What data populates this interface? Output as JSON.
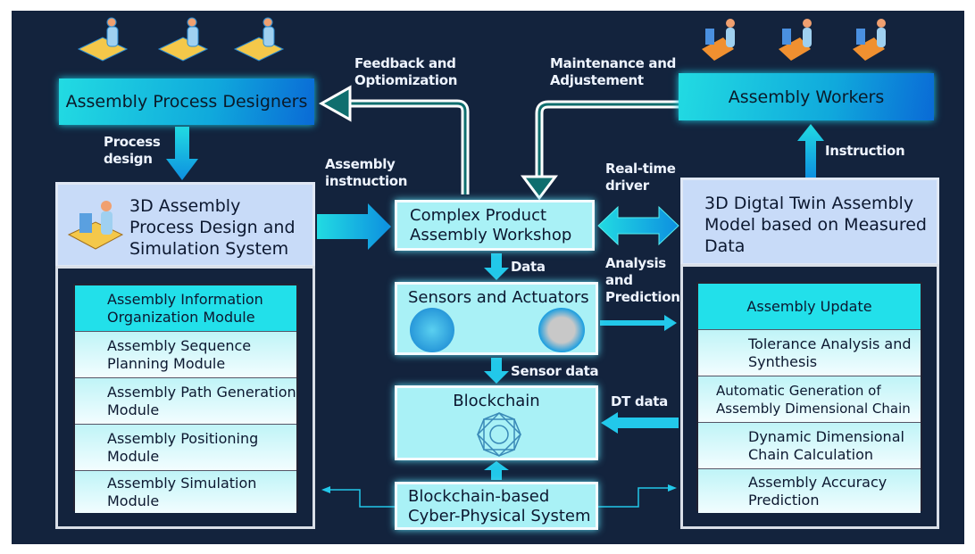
{
  "designers": {
    "title": "Assembly Process Designers",
    "icon": "designer-person-icon"
  },
  "workers": {
    "title": "Assembly Workers",
    "icon": "worker-person-icon"
  },
  "design_system": {
    "title": "3D Assembly Process Design and Simulation System",
    "modules": [
      "Assembly Information Organization Module",
      "Assembly Sequence Planning Module",
      "Assembly Path Generation Module",
      "Assembly Positioning Module",
      "Assembly Simulation Module"
    ]
  },
  "dt_model": {
    "title": "3D Digtal Twin Assembly Model based on Measured Data",
    "modules": [
      "Assembly Update",
      "Tolerance Analysis and Synthesis",
      "Automatic Generation of Assembly Dimensional Chain",
      "Dynamic Dimensional Chain Calculation",
      "Assembly Accuracy Prediction"
    ]
  },
  "workshop": {
    "title": "Complex Product Assembly Workshop"
  },
  "sensors": {
    "title": "Sensors and Actuators"
  },
  "blockchain": {
    "title": "Blockchain"
  },
  "cps": {
    "title": "Blockchain-based Cyber-Physical System"
  },
  "labels": {
    "feedback": "Feedback and Optiomization",
    "maintenance": "Maintenance and Adjustement",
    "process_design": "Process design",
    "assembly_instruction": "Assembly instnuction",
    "realtime": "Real-time driver",
    "instruction": "Instruction",
    "data": "Data",
    "analysis": "Analysis and Prediction",
    "sensor_data": "Sensor data",
    "dt_data": "DT data"
  },
  "colors": {
    "background": "#13233d",
    "accent": "#22dbe2",
    "panel": "#c8dbf8",
    "box": "#a9f1f6"
  }
}
